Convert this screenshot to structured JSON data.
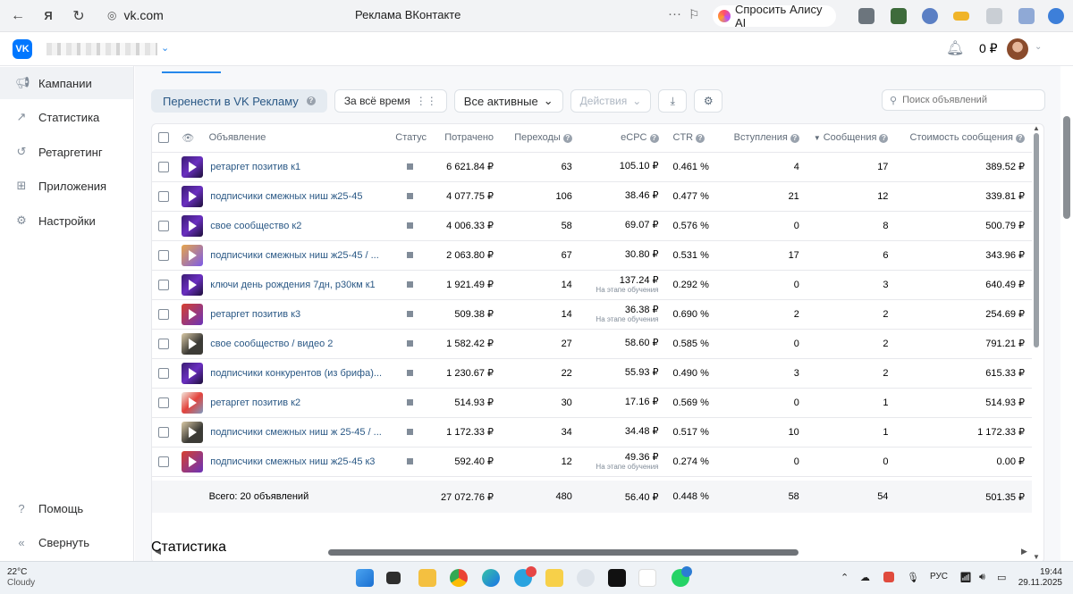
{
  "browser": {
    "url": "vk.com",
    "page_title": "Реклама ВКонтакте",
    "alisa_label": "Спросить Алису AI"
  },
  "header": {
    "logo_text": "VK",
    "balance": "0 ₽"
  },
  "sidebar": {
    "items": [
      {
        "label": "Кампании",
        "icon": "megaphone-icon"
      },
      {
        "label": "Статистика",
        "icon": "chart-line-icon"
      },
      {
        "label": "Ретаргетинг",
        "icon": "retarget-icon"
      },
      {
        "label": "Приложения",
        "icon": "apps-grid-icon"
      },
      {
        "label": "Настройки",
        "icon": "gear-icon"
      }
    ],
    "help": "Помощь",
    "collapse": "Свернуть"
  },
  "toolbar": {
    "migrate": "Перенести в VK Рекламу",
    "period": "За всё время",
    "filter": "Все активные",
    "actions": "Действия",
    "search_placeholder": "Поиск объявлений"
  },
  "table": {
    "columns": [
      "Объявление",
      "Статус",
      "Потрачено",
      "Переходы",
      "eCPC",
      "CTR",
      "Вступления",
      "Сообщения",
      "Стоимость сообщения"
    ],
    "rows": [
      {
        "name": "ретаргет позитив к1",
        "spent": "6 621.84 ₽",
        "clicks": "63",
        "ecpc": "105.10 ₽",
        "ecpc_note": "",
        "ctr": "0.461 %",
        "joins": "4",
        "messages": "17",
        "msg_cost": "389.52 ₽"
      },
      {
        "name": "подписчики смежных ниш ж25-45",
        "spent": "4 077.75 ₽",
        "clicks": "106",
        "ecpc": "38.46 ₽",
        "ecpc_note": "",
        "ctr": "0.477 %",
        "joins": "21",
        "messages": "12",
        "msg_cost": "339.81 ₽"
      },
      {
        "name": "свое сообщество к2",
        "spent": "4 006.33 ₽",
        "clicks": "58",
        "ecpc": "69.07 ₽",
        "ecpc_note": "",
        "ctr": "0.576 %",
        "joins": "0",
        "messages": "8",
        "msg_cost": "500.79 ₽"
      },
      {
        "name": "подписчики смежных ниш ж25-45 / ...",
        "spent": "2 063.80 ₽",
        "clicks": "67",
        "ecpc": "30.80 ₽",
        "ecpc_note": "",
        "ctr": "0.531 %",
        "joins": "17",
        "messages": "6",
        "msg_cost": "343.96 ₽"
      },
      {
        "name": "ключи день рождения 7дн, р30км к1",
        "spent": "1 921.49 ₽",
        "clicks": "14",
        "ecpc": "137.24 ₽",
        "ecpc_note": "На этапе обучения",
        "ctr": "0.292 %",
        "joins": "0",
        "messages": "3",
        "msg_cost": "640.49 ₽"
      },
      {
        "name": "ретаргет позитив к3",
        "spent": "509.38 ₽",
        "clicks": "14",
        "ecpc": "36.38 ₽",
        "ecpc_note": "На этапе обучения",
        "ctr": "0.690 %",
        "joins": "2",
        "messages": "2",
        "msg_cost": "254.69 ₽"
      },
      {
        "name": "свое сообщество / видео 2",
        "spent": "1 582.42 ₽",
        "clicks": "27",
        "ecpc": "58.60 ₽",
        "ecpc_note": "",
        "ctr": "0.585 %",
        "joins": "0",
        "messages": "2",
        "msg_cost": "791.21 ₽"
      },
      {
        "name": "подписчики конкурентов (из брифа)...",
        "spent": "1 230.67 ₽",
        "clicks": "22",
        "ecpc": "55.93 ₽",
        "ecpc_note": "",
        "ctr": "0.490 %",
        "joins": "3",
        "messages": "2",
        "msg_cost": "615.33 ₽"
      },
      {
        "name": "ретаргет позитив к2",
        "spent": "514.93 ₽",
        "clicks": "30",
        "ecpc": "17.16 ₽",
        "ecpc_note": "",
        "ctr": "0.569 %",
        "joins": "0",
        "messages": "1",
        "msg_cost": "514.93 ₽"
      },
      {
        "name": "подписчики смежных ниш ж 25-45 / ...",
        "spent": "1 172.33 ₽",
        "clicks": "34",
        "ecpc": "34.48 ₽",
        "ecpc_note": "",
        "ctr": "0.517 %",
        "joins": "10",
        "messages": "1",
        "msg_cost": "1 172.33 ₽"
      },
      {
        "name": "подписчики смежных ниш ж25-45 к3",
        "spent": "592.40 ₽",
        "clicks": "12",
        "ecpc": "49.36 ₽",
        "ecpc_note": "На этапе обучения",
        "ctr": "0.274 %",
        "joins": "0",
        "messages": "0",
        "msg_cost": "0.00 ₽"
      }
    ],
    "total": {
      "label": "Всего: 20 объявлений",
      "spent": "27 072.76 ₽",
      "clicks": "480",
      "ecpc": "56.40 ₽",
      "ctr": "0.448 %",
      "joins": "58",
      "messages": "54",
      "msg_cost": "501.35 ₽"
    }
  },
  "section_title": "Статистика",
  "taskbar": {
    "temp": "22°C",
    "weather": "Cloudy",
    "lang": "РУС",
    "time": "19:44",
    "date": "29.11.2025"
  }
}
